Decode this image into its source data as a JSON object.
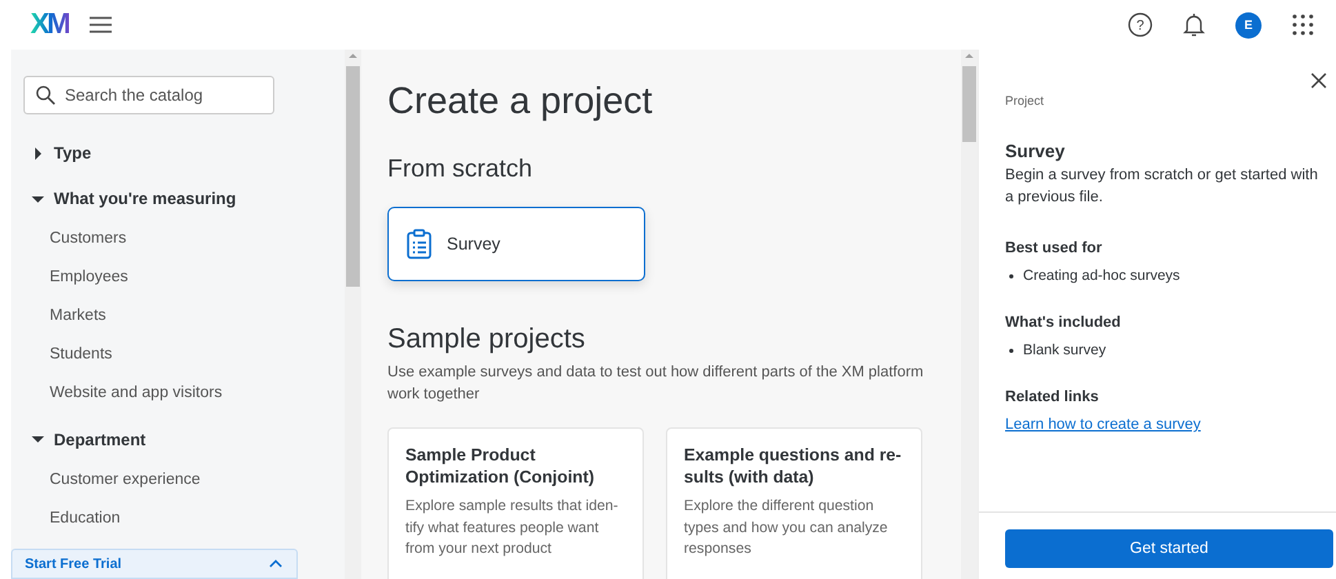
{
  "header": {
    "logo": "XM",
    "help_glyph": "?",
    "avatar_initial": "E"
  },
  "sidebar": {
    "search": {
      "placeholder": "Search the catalog"
    },
    "filters": [
      {
        "label": "Type",
        "expanded": false
      },
      {
        "label": "What you're measuring",
        "expanded": true,
        "items": [
          "Customers",
          "Employees",
          "Markets",
          "Students",
          "Website and app visitors"
        ]
      },
      {
        "label": "Department",
        "expanded": true,
        "items": [
          "Customer experience",
          "Education"
        ]
      }
    ],
    "trial_banner": {
      "label": "Start Free Trial"
    }
  },
  "main": {
    "title": "Create a project",
    "from_scratch": {
      "heading": "From scratch",
      "tiles": [
        {
          "label": "Survey",
          "selected": true
        }
      ]
    },
    "sample_projects": {
      "heading": "Sample projects",
      "description": "Use example surveys and data to test out how different parts of the XM platform work together",
      "cards": [
        {
          "title": "Sample Product Optimization (Conjoint)",
          "description": "Explore sample results that iden-tify what features people want from your next product"
        },
        {
          "title": "Example questions and re-sults (with data)",
          "description": "Explore the different question types and how you can analyze responses"
        }
      ]
    }
  },
  "panel": {
    "eyebrow": "Project",
    "title": "Survey",
    "description": "Begin a survey from scratch or get started with a previous file.",
    "sections": [
      {
        "heading": "Best used for",
        "bullets": [
          "Creating ad-hoc surveys"
        ]
      },
      {
        "heading": "What's included",
        "bullets": [
          "Blank survey"
        ]
      }
    ],
    "related": {
      "heading": "Related links",
      "links": [
        "Learn how to create a survey"
      ]
    },
    "button": "Get started"
  }
}
